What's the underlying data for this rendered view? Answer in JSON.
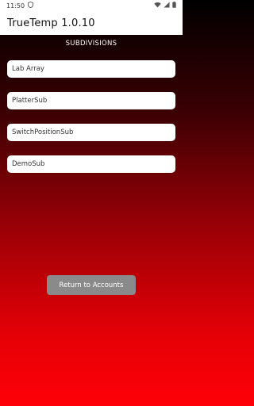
{
  "status_bar": {
    "time": "11:50",
    "icons": [
      "shield-icon",
      "wifi-icon",
      "signal-icon",
      "battery-icon"
    ]
  },
  "app_bar": {
    "title": "TrueTemp 1.0.10"
  },
  "main": {
    "section_title": "SUBDIVISIONS",
    "subdivisions": [
      {
        "label": "Lab Array"
      },
      {
        "label": "PlatterSub"
      },
      {
        "label": "SwitchPositionSub"
      },
      {
        "label": "DemoSub"
      }
    ],
    "return_button_label": "Return to Accounts"
  },
  "colors": {
    "gradient_top": "#000000",
    "gradient_bottom": "#ff0007",
    "button_gray": "#8a8a8a"
  }
}
